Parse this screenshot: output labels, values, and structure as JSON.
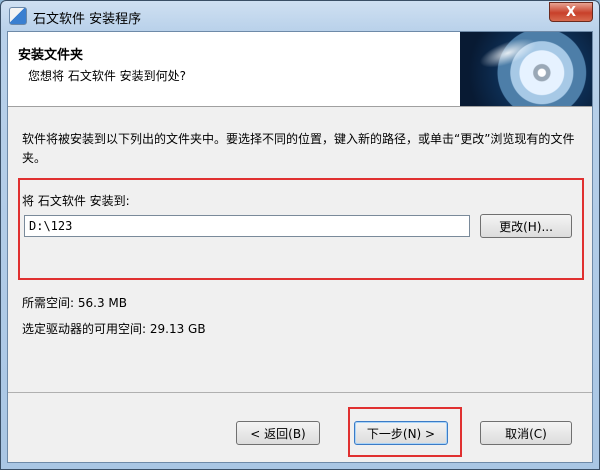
{
  "window": {
    "title": "石文软件 安装程序",
    "close_label": "X",
    "icon": "installer-icon"
  },
  "header": {
    "title": "安装文件夹",
    "subtitle": "您想将 石文软件 安装到何处?",
    "banner_icon": "cd-disc-image"
  },
  "body": {
    "description": "软件将被安装到以下列出的文件夹中。要选择不同的位置，键入新的路径，或单击“更改”浏览现有的文件夹。",
    "destination_label": "将 石文软件 安装到:",
    "path_value": "D:\\123",
    "browse_label": "更改(H)...",
    "space_required": "所需空间: 56.3 MB",
    "space_available": "选定驱动器的可用空间: 29.13 GB"
  },
  "footer": {
    "back_label": "< 返回(B)",
    "next_label": "下一步(N) >",
    "cancel_label": "取消(C)"
  },
  "colors": {
    "highlight_box": "#e03030",
    "titlebar": "#b9d1ea",
    "dialog_bg": "#f0f0f0"
  }
}
